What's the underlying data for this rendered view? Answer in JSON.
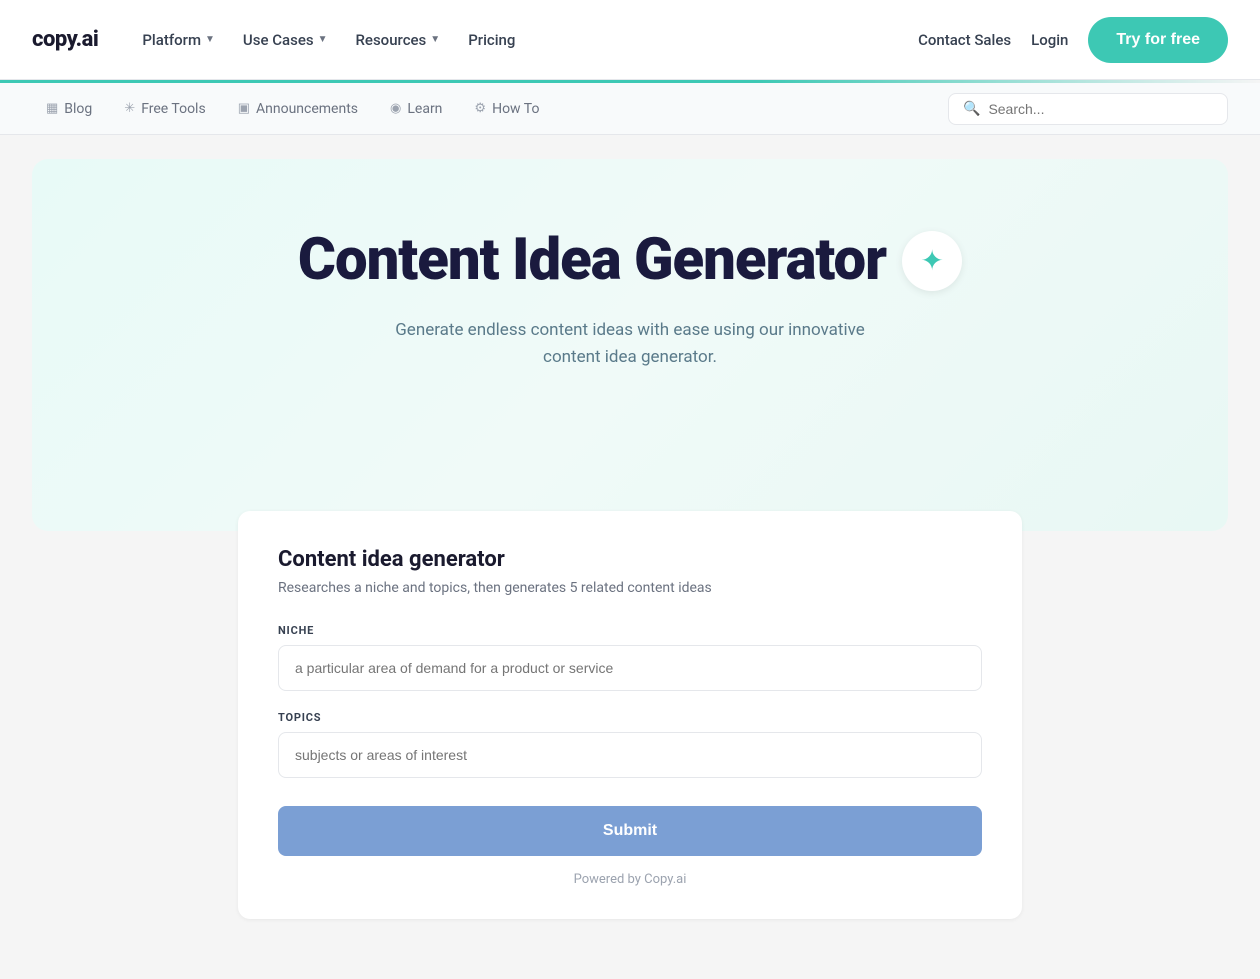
{
  "logo": {
    "text": "copy.ai"
  },
  "navbar": {
    "platform_label": "Platform",
    "use_cases_label": "Use Cases",
    "resources_label": "Resources",
    "pricing_label": "Pricing",
    "contact_sales_label": "Contact Sales",
    "login_label": "Login",
    "try_free_label": "Try for free"
  },
  "sub_nav": {
    "items": [
      {
        "label": "Blog",
        "icon": "📄"
      },
      {
        "label": "Free Tools",
        "icon": "🔧"
      },
      {
        "label": "Announcements",
        "icon": "📋"
      },
      {
        "label": "Learn",
        "icon": "🔵"
      },
      {
        "label": "How To",
        "icon": "⚙️"
      }
    ],
    "search_placeholder": "Search..."
  },
  "hero": {
    "title": "Content Idea Generator",
    "subtitle": "Generate endless content ideas with ease using our innovative content idea generator."
  },
  "tool": {
    "title": "Content idea generator",
    "description": "Researches a niche and topics, then generates 5 related content ideas",
    "niche_label": "NICHE",
    "niche_placeholder": "a particular area of demand for a product or service",
    "topics_label": "TOPICS",
    "topics_placeholder": "subjects or areas of interest",
    "submit_label": "Submit",
    "powered_by": "Powered by Copy.ai"
  }
}
